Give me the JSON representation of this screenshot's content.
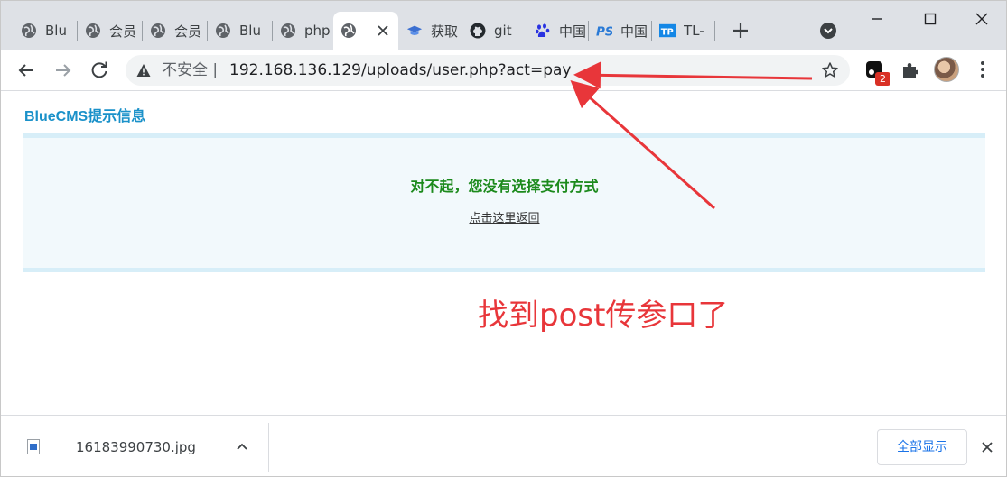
{
  "tabs": [
    {
      "label": "Blu",
      "icon": "globe-icon"
    },
    {
      "label": "会员",
      "icon": "globe-icon"
    },
    {
      "label": "会员",
      "icon": "globe-icon"
    },
    {
      "label": "Blu",
      "icon": "globe-icon"
    },
    {
      "label": "php",
      "icon": "globe-icon"
    },
    {
      "label": "",
      "icon": "globe-icon",
      "active": true
    },
    {
      "label": "获取",
      "icon": "graduation-cap-icon"
    },
    {
      "label": "git",
      "icon": "github-icon"
    },
    {
      "label": "中国",
      "icon": "baidu-paw-icon"
    },
    {
      "label": "中国",
      "icon": "ps-logo-icon"
    },
    {
      "label": "TL-",
      "icon": "tp-logo-icon"
    }
  ],
  "address_bar": {
    "security_label": "不安全",
    "url": "192.168.136.129/uploads/user.php?act=pay"
  },
  "extension_badge": "2",
  "page": {
    "site_title": "BlueCMS提示信息",
    "message": "对不起，您没有选择支付方式",
    "back_link": "点击这里返回"
  },
  "annotation": {
    "text": "找到post传参口了",
    "color": "#e8363a"
  },
  "download_bar": {
    "file_name": "16183990730.jpg",
    "show_all": "全部显示"
  },
  "colors": {
    "title_blue": "#1a91c9",
    "message_green": "#1c8a1c",
    "message_bg": "#f2f9fc",
    "tabstrip_bg": "#dee1e6"
  }
}
